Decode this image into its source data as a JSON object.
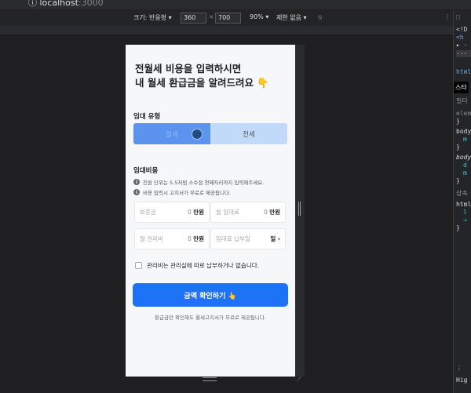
{
  "browser": {
    "url_host": "localhost",
    "url_port": ":3000"
  },
  "device_toolbar": {
    "size_label": "크기: 반응형 ▾",
    "width": "360",
    "times": "×",
    "height": "700",
    "zoom": "90% ▾",
    "throttle": "제한 없음 ▾",
    "rotate_icon": "rotate-icon",
    "more_icon": "⋮"
  },
  "devtools": {
    "lines": [
      "<!D",
      "<h",
      "▸ ·",
      "··· ▾",
      "html",
      "스타",
      "필터",
      "elem",
      "}",
      "body",
      "m",
      "}",
      "body",
      "d",
      "m",
      "}",
      "상속",
      "html",
      "l",
      "→",
      "}"
    ],
    "bottom": "Hig"
  },
  "page": {
    "title_line1": "전월세 비용을 입력하시면",
    "title_line2": "내 월세 환급금을 알려드려요 👇",
    "rental_type_label": "임대 유형",
    "rental_types": [
      {
        "label": "월세",
        "selected": true
      },
      {
        "label": "전세",
        "selected": false
      }
    ],
    "cost_label": "임대비용",
    "notes": [
      "천원 단위는 5.5처럼 소수점 첫째자리까지 입력해주세요.",
      "비용 입력시 고지서가 무료로 제공됩니다."
    ],
    "fields": [
      {
        "label": "보증금",
        "value": "0",
        "unit": "만원"
      },
      {
        "label": "월 임대료",
        "value": "0",
        "unit": "만원"
      },
      {
        "label": "월 관리비",
        "value": "0",
        "unit": "만원"
      },
      {
        "label": "임대료 납부일",
        "value": "",
        "unit": "일 ›"
      }
    ],
    "checkbox_label": "관리비는 관리실에 따로 납부하거나 없습니다.",
    "checkbox_checked": false,
    "cta_label": "금액 확인하기 👆",
    "footer": "환급금만 확인해도 월세고지서가 무료로 제공됩니다."
  },
  "colors": {
    "primary": "#1e72f6",
    "selected_tab": "#5b93ee",
    "unselected_tab": "#c2dafa"
  }
}
